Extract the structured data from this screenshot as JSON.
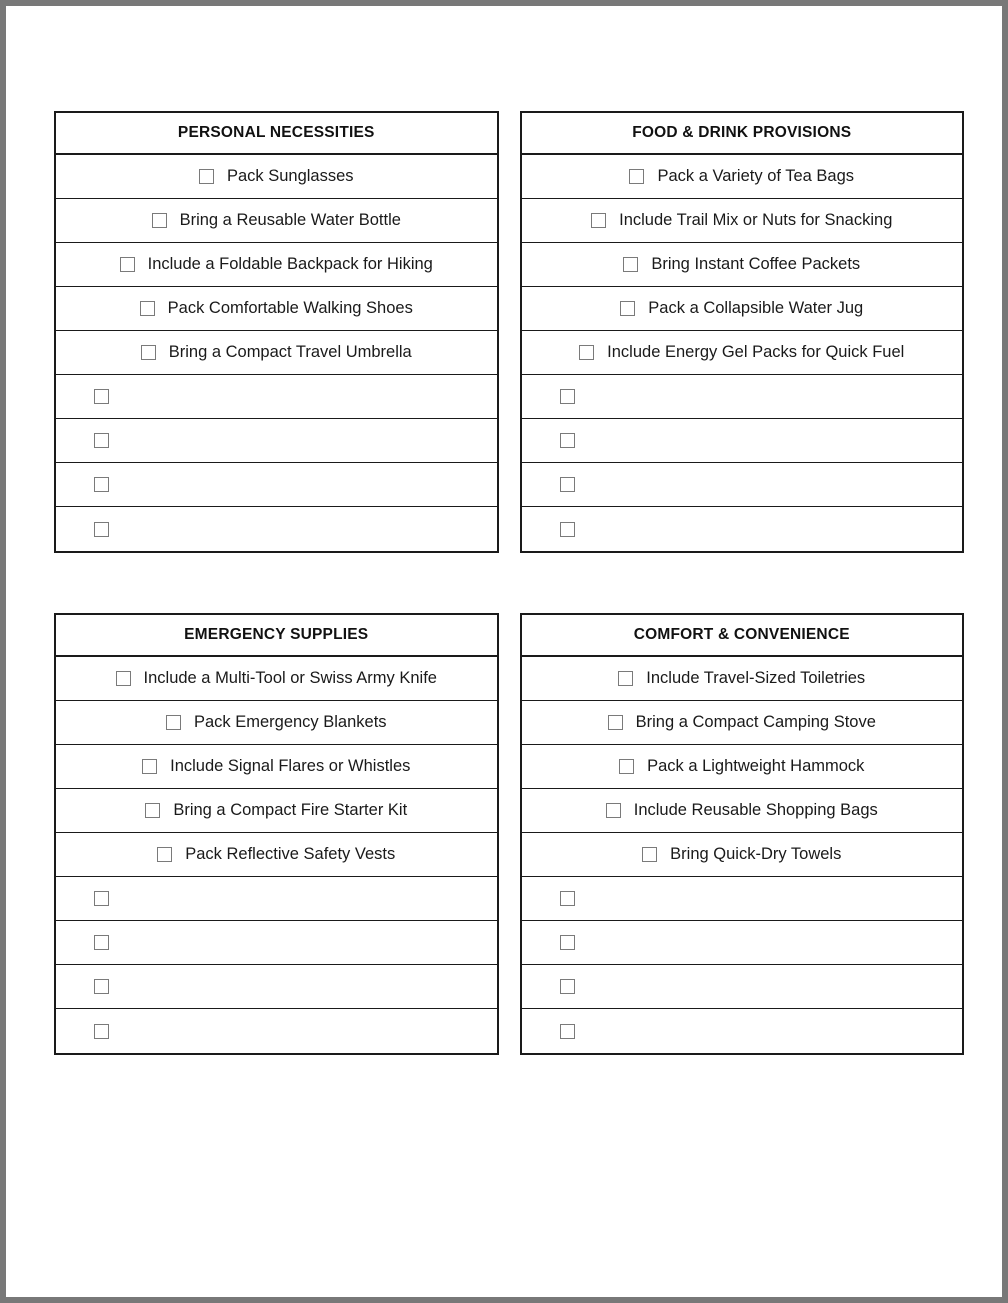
{
  "document": {
    "type": "printable-checklist",
    "page_background": "#ffffff",
    "canvas_background": "#787878",
    "text_color": "#1a1a1a",
    "border_color": "#1a1a1a",
    "checkbox_border_color": "#7a7a7a",
    "checkbox_icon": "empty-checkbox-icon",
    "empty_rows_per_table": 4
  },
  "tables": [
    {
      "title": "PERSONAL NECESSITIES",
      "items": [
        "Pack Sunglasses",
        "Bring a Reusable Water Bottle",
        "Include a Foldable Backpack for Hiking",
        "Pack Comfortable Walking Shoes",
        "Bring a Compact Travel Umbrella"
      ],
      "empty_rows": 4
    },
    {
      "title": "FOOD & DRINK PROVISIONS",
      "items": [
        "Pack a Variety of Tea Bags",
        "Include Trail Mix or Nuts for Snacking",
        "Bring Instant Coffee Packets",
        "Pack a Collapsible Water Jug",
        "Include Energy Gel Packs for Quick Fuel"
      ],
      "empty_rows": 4
    },
    {
      "title": "EMERGENCY SUPPLIES",
      "items": [
        "Include a Multi-Tool or Swiss Army Knife",
        "Pack Emergency Blankets",
        "Include Signal Flares or Whistles",
        "Bring a Compact Fire Starter Kit",
        "Pack Reflective Safety Vests"
      ],
      "empty_rows": 4
    },
    {
      "title": "COMFORT & CONVENIENCE",
      "items": [
        "Include Travel-Sized Toiletries",
        "Bring a Compact Camping Stove",
        "Pack a Lightweight Hammock",
        "Include Reusable Shopping Bags",
        "Bring Quick-Dry Towels"
      ],
      "empty_rows": 4
    }
  ]
}
